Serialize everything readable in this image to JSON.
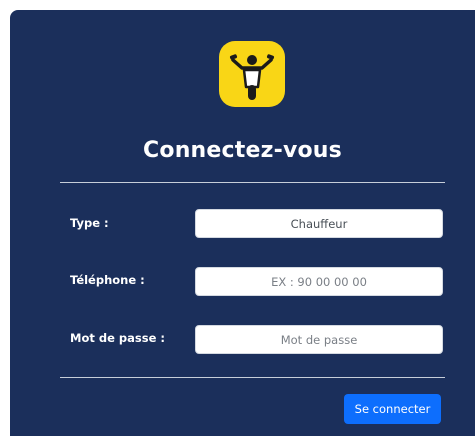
{
  "brand": {
    "logo_icon": "scooter-rider-icon",
    "logo_color": "#f9d616"
  },
  "title": "Connectez-vous",
  "form": {
    "type": {
      "label": "Type :",
      "value": "Chauffeur"
    },
    "phone": {
      "label": "Téléphone :",
      "placeholder": "EX : 90 00 00 00"
    },
    "password": {
      "label": "Mot de passe :",
      "placeholder": "Mot de passe"
    },
    "submit_label": "Se connecter"
  },
  "colors": {
    "card_background": "#1b2f5b",
    "primary_button": "#0d6efd"
  }
}
